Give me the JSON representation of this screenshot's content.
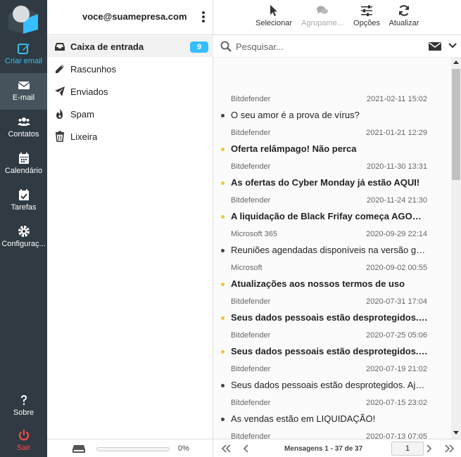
{
  "rail": {
    "compose": "Criar email",
    "email": "E-mail",
    "contacts": "Contatos",
    "calendar": "Calendário",
    "tasks": "Tarefas",
    "settings": "Configuraç...",
    "about": "Sobre",
    "logout": "Sair"
  },
  "account": {
    "email": "voce@suamepresa.com"
  },
  "folders": [
    {
      "label": "Caixa de entrada",
      "icon": "inbox-icon",
      "badge": "9"
    },
    {
      "label": "Rascunhos",
      "icon": "pencil-icon"
    },
    {
      "label": "Enviados",
      "icon": "paper-plane-icon"
    },
    {
      "label": "Spam",
      "icon": "fire-icon"
    },
    {
      "label": "Lixeira",
      "icon": "trash-icon"
    }
  ],
  "quota": {
    "percent_label": "0%",
    "fraction": 0.0
  },
  "toolbar": {
    "select": "Selecionar",
    "group": "Agrupame...",
    "options": "Opções",
    "refresh": "Atualizar"
  },
  "search": {
    "placeholder": "Pesquisar..."
  },
  "messages": [
    {
      "from": "Bitdefender",
      "date": "2021-02-11 15:02",
      "subject": "O seu amor é a prova de vírus?",
      "unread": false
    },
    {
      "from": "Bitdefender",
      "date": "2021-01-21 12:29",
      "subject": "Oferta relâmpago! Não perca",
      "unread": true
    },
    {
      "from": "Bitdefender",
      "date": "2020-11-30 13:31",
      "subject": "As ofertas do Cyber Monday já estão AQUI!",
      "unread": true
    },
    {
      "from": "Bitdefender",
      "date": "2020-11-24 21:30",
      "subject": "A liquidação de Black Frifay começa AGORA!",
      "unread": true
    },
    {
      "from": "Microsoft 365",
      "date": "2020-09-29 22:14",
      "subject": "Reuniões agendadas disponíveis na versão grat...",
      "unread": false
    },
    {
      "from": "Microsoft",
      "date": "2020-09-02 00:55",
      "subject": "Atualizações aos nossos termos de uso",
      "unread": true
    },
    {
      "from": "Bitdefender",
      "date": "2020-07-31 17:04",
      "subject": "Seus dados pessoais estão desprotegidos. Aja ...",
      "unread": true
    },
    {
      "from": "Bitdefender",
      "date": "2020-07-25 05:06",
      "subject": "Seus dados pessoais estão desprotegidos. Aja ...",
      "unread": true
    },
    {
      "from": "Bitdefender",
      "date": "2020-07-19 21:02",
      "subject": "Seus dados pessoais estão desprotegidos. Aja ...",
      "unread": false
    },
    {
      "from": "Bitdefender",
      "date": "2020-07-15 23:02",
      "subject": "As vendas estão em LIQUIDAÇÃO!",
      "unread": false
    },
    {
      "from": "Bitdefender",
      "date": "2020-07-13 07:05",
      "subject": "",
      "unread": false
    }
  ],
  "pager": {
    "info": "Mensagens 1 - 37 de 37",
    "page": "1"
  },
  "colors": {
    "accent": "#37beff",
    "rail": "#2f3a42",
    "unread_dot": "#f5c33b",
    "logout": "#ff4b4b"
  }
}
